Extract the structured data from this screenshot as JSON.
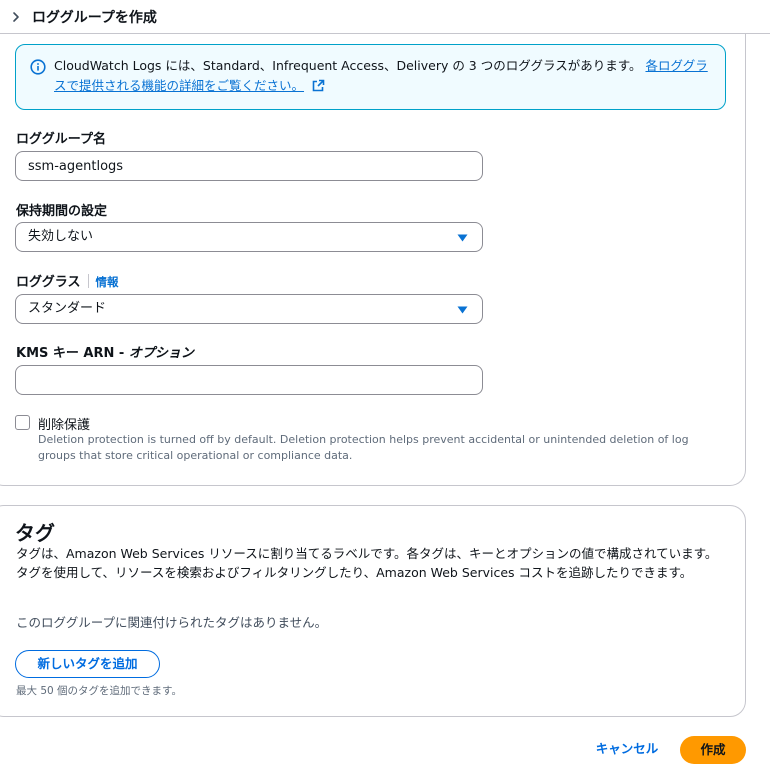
{
  "breadcrumb": {
    "title": "ロググループを作成"
  },
  "info_alert": {
    "text": "CloudWatch Logs には、Standard、Infrequent Access、Delivery の 3 つのロググラスがあります。",
    "link": "各ロググラスで提供される機能の詳細をご覧ください。"
  },
  "log_group_name": {
    "label": "ロググループ名",
    "value": "ssm-agentlogs"
  },
  "retention": {
    "label": "保持期間の設定",
    "value": "失効しない"
  },
  "log_class": {
    "label": "ロググラス",
    "info": "情報",
    "value": "スタンダード"
  },
  "kms": {
    "label": "KMS キー ARN - ",
    "optional": "オプション",
    "value": ""
  },
  "deletion_protection": {
    "label": "削除保護",
    "description": "Deletion protection is turned off by default. Deletion protection helps prevent accidental or unintended deletion of log groups that store critical operational or compliance data."
  },
  "tags": {
    "heading": "タグ",
    "description": "タグは、Amazon Web Services リソースに割り当てるラベルです。各タグは、キーとオプションの値で構成されています。タグを使用して、リソースを検索およびフィルタリングしたり、Amazon Web Services コストを追跡したりできます。",
    "none": "このロググループに関連付けられたタグはありません。",
    "add_button": "新しいタグを追加",
    "limit": "最大 50 個のタグを追加できます。"
  },
  "footer": {
    "cancel": "キャンセル",
    "create": "作成"
  },
  "colors": {
    "accent": "#006ce0",
    "primary_button": "#ff9900",
    "info_border": "#00a1c9"
  }
}
